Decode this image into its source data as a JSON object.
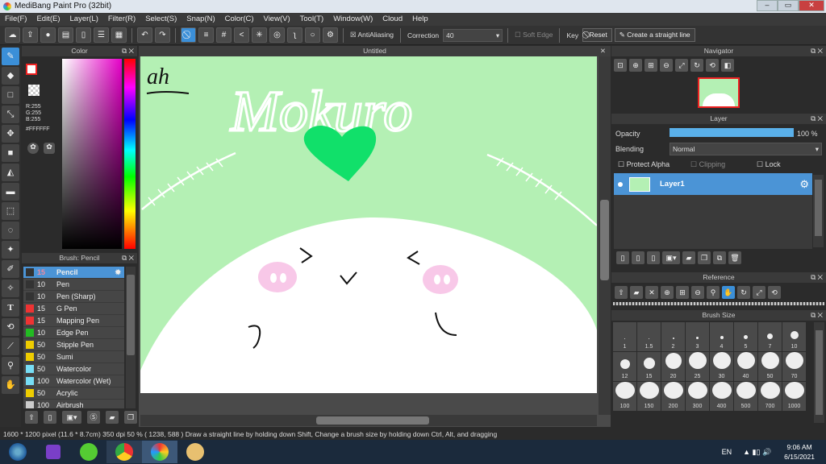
{
  "window": {
    "title": "MediBang Paint Pro (32bit)"
  },
  "menu": [
    "File(F)",
    "Edit(E)",
    "Layer(L)",
    "Filter(R)",
    "Select(S)",
    "Snap(N)",
    "Color(C)",
    "View(V)",
    "Tool(T)",
    "Window(W)",
    "Cloud",
    "Help"
  ],
  "toolbar": {
    "antialiasing": "AntiAliasing",
    "correction_label": "Correction",
    "correction_value": "40",
    "soft_edge": "Soft Edge",
    "key": "Key",
    "reset": "Reset",
    "straight_line": "Create a straight line"
  },
  "color_panel": {
    "title": "Color",
    "r": "R:255",
    "g": "G:255",
    "b": "B:255",
    "hex": "#FFFFFF"
  },
  "brush_panel": {
    "title": "Brush: Pencil",
    "items": [
      {
        "size": "15",
        "name": "Pencil",
        "color": "#333333"
      },
      {
        "size": "10",
        "name": "Pen",
        "color": "#333333"
      },
      {
        "size": "10",
        "name": "Pen (Sharp)",
        "color": "#333333"
      },
      {
        "size": "15",
        "name": "G Pen",
        "color": "#ee3333"
      },
      {
        "size": "15",
        "name": "Mapping Pen",
        "color": "#ee3333"
      },
      {
        "size": "10",
        "name": "Edge Pen",
        "color": "#22bb22"
      },
      {
        "size": "50",
        "name": "Stipple Pen",
        "color": "#eecc00"
      },
      {
        "size": "50",
        "name": "Sumi",
        "color": "#eecc00"
      },
      {
        "size": "50",
        "name": "Watercolor",
        "color": "#77ddf5"
      },
      {
        "size": "100",
        "name": "Watercolor (Wet)",
        "color": "#77ddf5"
      },
      {
        "size": "50",
        "name": "Acrylic",
        "color": "#eecc00"
      },
      {
        "size": "100",
        "name": "Airbrush",
        "color": "#cccccc"
      }
    ]
  },
  "canvas": {
    "tab": "Untitled",
    "text_ah": "ah",
    "text_title": "Mokuro",
    "bg": "#b4f0b4",
    "heart": "#11e06a"
  },
  "navigator": {
    "title": "Navigator"
  },
  "layer_panel": {
    "title": "Layer",
    "opacity_label": "Opacity",
    "opacity_value": "100 %",
    "opacity": 1.0,
    "blending_label": "Blending",
    "blending_value": "Normal",
    "protect_alpha": "Protect Alpha",
    "clipping": "Clipping",
    "lock": "Lock",
    "layers": [
      {
        "name": "Layer1"
      }
    ]
  },
  "reference": {
    "title": "Reference"
  },
  "brush_size": {
    "title": "Brush Size",
    "sizes": [
      "1",
      "1.5",
      "2",
      "3",
      "4",
      "5",
      "7",
      "10",
      "12",
      "15",
      "20",
      "25",
      "30",
      "40",
      "50",
      "70",
      "100",
      "150",
      "200",
      "300",
      "400",
      "500",
      "700",
      "1000"
    ]
  },
  "status": "1600 * 1200 pixel   (11.6 * 8.7cm)   350 dpi   50 %   ( 1238, 588 )   Draw a straight line by holding down Shift, Change a brush size by holding down Ctrl, Alt, and dragging",
  "taskbar": {
    "lang": "EN",
    "time": "9:06 AM",
    "date": "6/15/2021"
  }
}
